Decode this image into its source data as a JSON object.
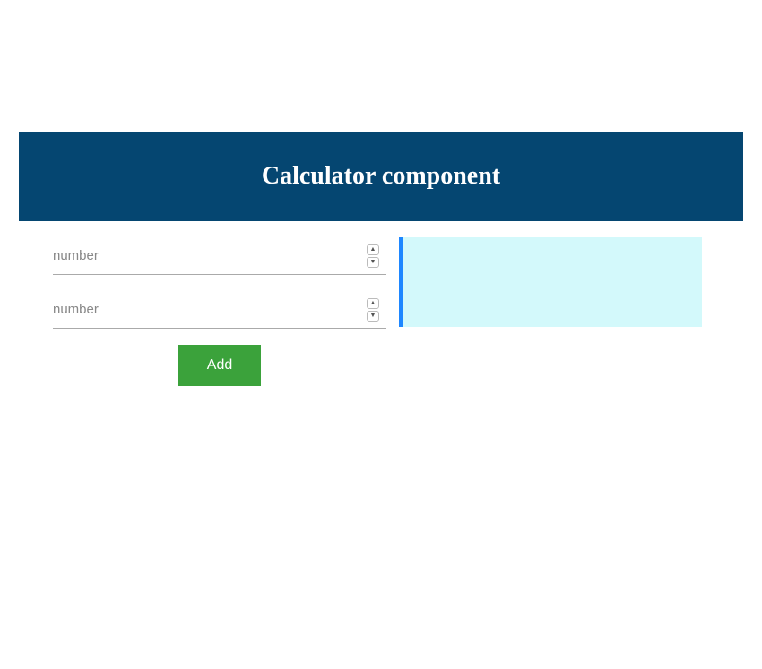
{
  "header": {
    "title": "Calculator component"
  },
  "form": {
    "input1": {
      "placeholder": "number",
      "value": ""
    },
    "input2": {
      "placeholder": "number",
      "value": ""
    },
    "add_label": "Add"
  },
  "result": {
    "value": ""
  },
  "colors": {
    "header_bg": "#054671",
    "button_bg": "#3ba23b",
    "result_bg": "#d3f9fb",
    "result_border": "#1e87ff"
  }
}
